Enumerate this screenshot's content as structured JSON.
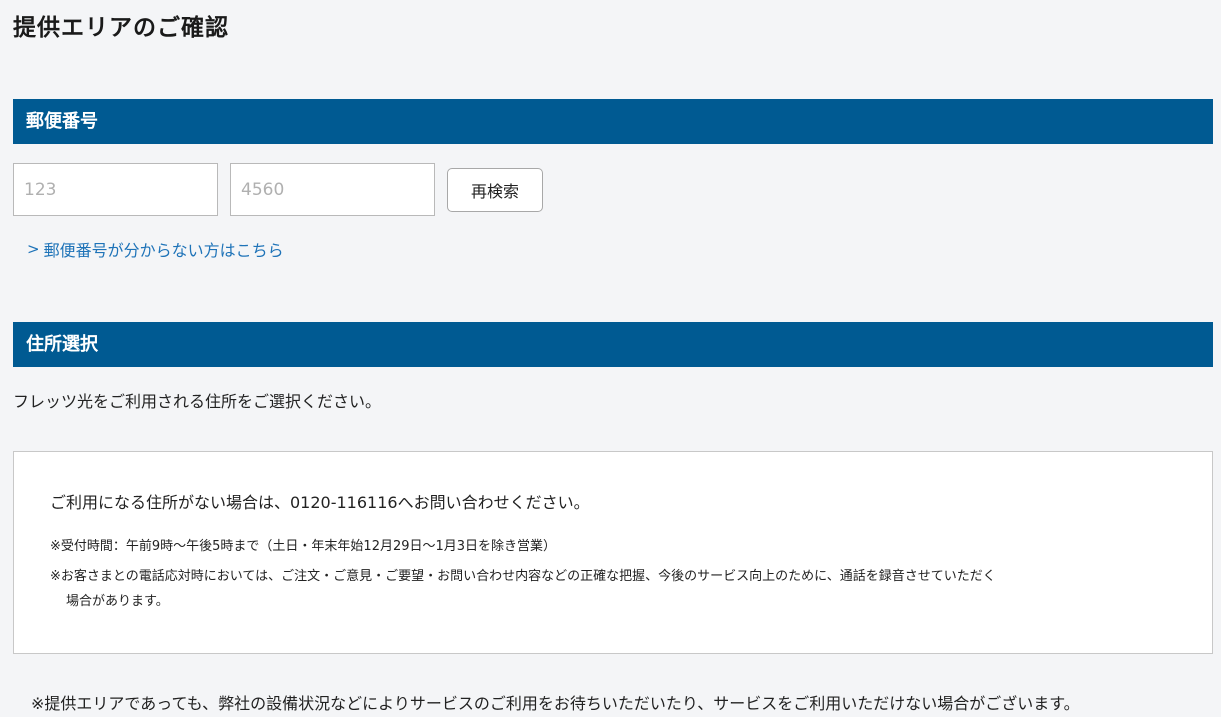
{
  "page": {
    "title": "提供エリアのご確認"
  },
  "postal": {
    "section_title": "郵便番号",
    "field1_placeholder": "123",
    "field2_placeholder": "4560",
    "research_label": "再検索",
    "help_link": "郵便番号が分からない方はこちら",
    "help_link_prefix": ">"
  },
  "address": {
    "section_title": "住所選択",
    "description": "フレッツ光をご利用される住所をご選択ください。"
  },
  "info": {
    "main": "ご利用になる住所がない場合は、0120-116116へお問い合わせください。",
    "note1": "※受付時間：午前9時〜午後5時まで（土日・年末年始12月29日〜1月3日を除き営業）",
    "note2_line1": "※お客さまとの電話応対時においては、ご注文・ご意見・ご要望・お問い合わせ内容などの正確な把握、今後のサービス向上のために、通話を録音させていただく",
    "note2_line2": "場合があります。"
  },
  "footer": {
    "note": "※提供エリアであっても、弊社の設備状況などによりサービスのご利用をお待ちいただいたり、サービスをご利用いただけない場合がございます。"
  },
  "colors": {
    "header_bg": "#005a92",
    "link": "#1e73b8",
    "page_bg": "#f4f5f7"
  }
}
